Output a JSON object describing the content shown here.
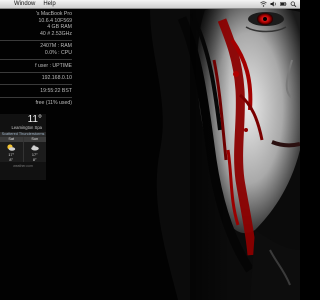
{
  "menubar": {
    "items": [
      "Window",
      "Help"
    ],
    "status_icons": [
      "wifi-icon",
      "volume-icon",
      "battery-icon",
      "spotlight-icon"
    ]
  },
  "system_info": {
    "model": "'s MacBook Pro",
    "os": "10.6.4 10F569",
    "ram_total": "4 GB RAM",
    "cpu": "40  # 2.53GHz",
    "ram_used": "2407M : RAM",
    "cpu_used": "0.0% : CPU",
    "uptime": "f user : UPTIME",
    "ip": "192.168.0.10",
    "time": "19:55:22 BST",
    "disk": "free (11% used)"
  },
  "weather": {
    "temperature": "11°",
    "location": "Leamington Spa",
    "condition": "Scattered Thunderstorms",
    "days": [
      {
        "name": "Sat",
        "icon": "sun-cloud-icon",
        "high": "17°",
        "low": "8°"
      },
      {
        "name": "Sun",
        "icon": "cloud-icon",
        "high": "17°",
        "low": "8°"
      }
    ],
    "footer": "weather.com"
  }
}
